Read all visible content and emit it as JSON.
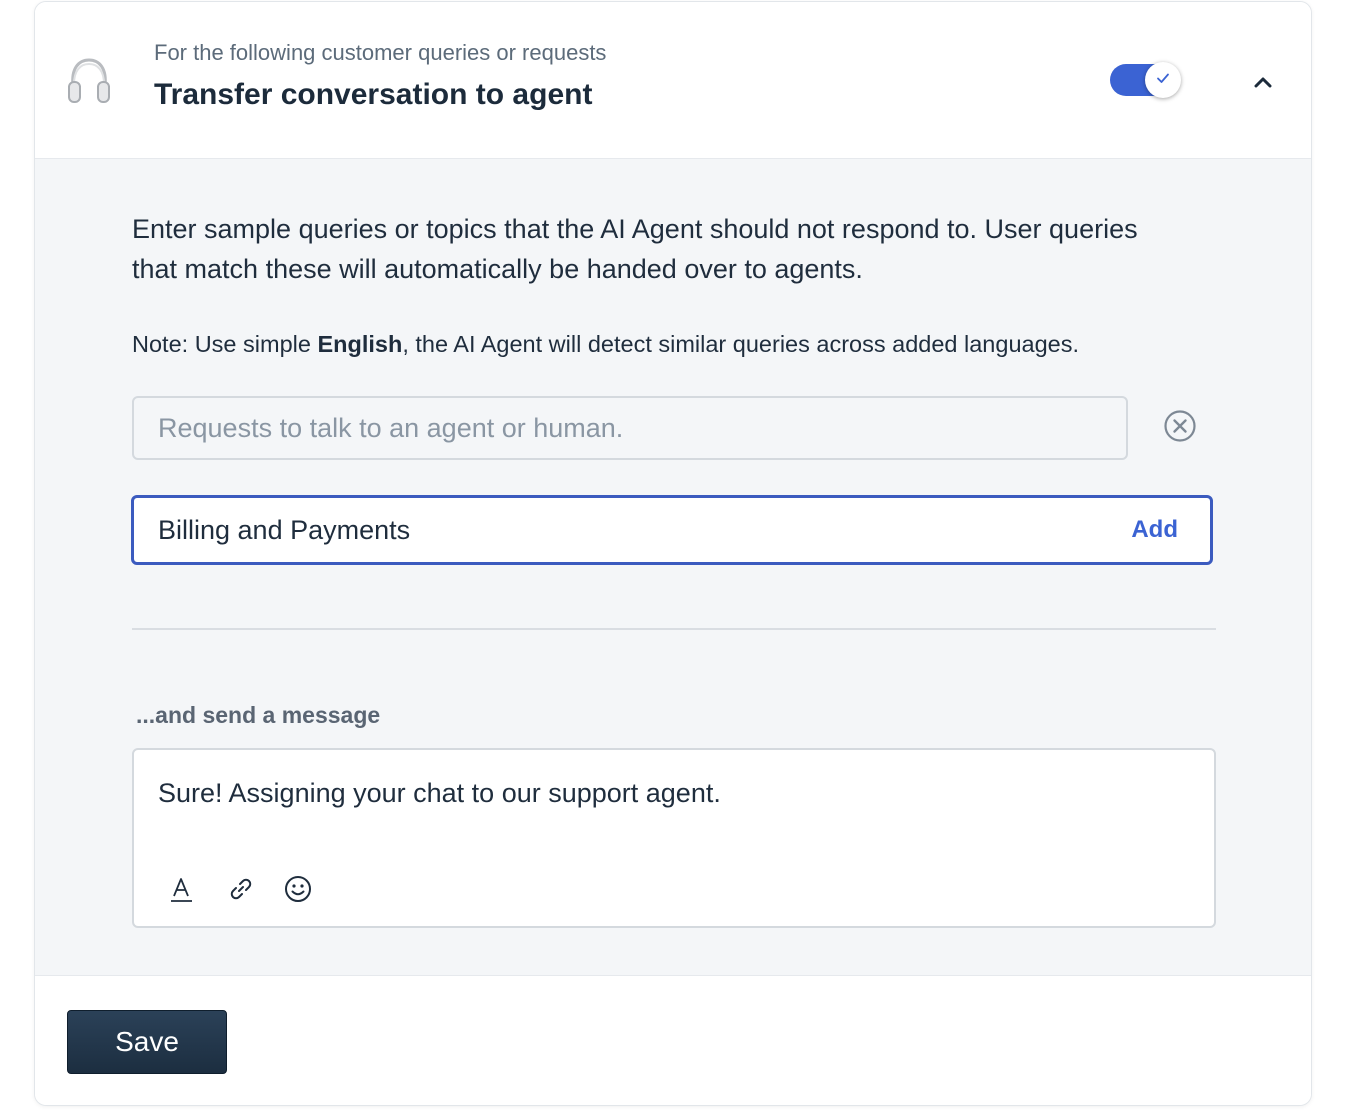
{
  "header": {
    "subtitle": "For the following customer queries or requests",
    "title": "Transfer conversation to agent",
    "toggle_on": true,
    "icon": "headphones-icon"
  },
  "body": {
    "description": "Enter sample queries or topics that the AI Agent should not respond to. User queries that match these will automatically be handed over to agents.",
    "note_prefix": "Note: Use simple ",
    "note_bold": "English",
    "note_suffix": ", the AI Agent will detect similar queries across added languages.",
    "existing_query": {
      "value": "",
      "placeholder": "Requests to talk to an agent or human."
    },
    "new_query": {
      "value": "Billing and Payments",
      "add_label": "Add"
    },
    "message_label": "...and send a message",
    "message_text": "Sure! Assigning your chat to our support agent."
  },
  "footer": {
    "save_label": "Save"
  },
  "colors": {
    "accent": "#3b63d3",
    "save_button": "#1f3347",
    "panel_bg": "#f4f6f8"
  }
}
